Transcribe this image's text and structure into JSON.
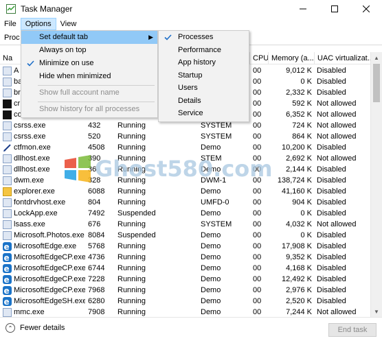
{
  "window": {
    "title": "Task Manager"
  },
  "menubar": {
    "file": "File",
    "options": "Options",
    "view": "View"
  },
  "tabs": {
    "processes_partial": "Proc"
  },
  "table": {
    "columns": {
      "name": "Na",
      "cpu": "CPU",
      "memory": "Memory (a...",
      "uac": "UAC virtualizat..."
    },
    "rows": [
      {
        "name": "A",
        "pid": "",
        "status": "",
        "user": "",
        "cpu": "00",
        "memory": "9,012 K",
        "uac": "Disabled",
        "icon": "exe-icon"
      },
      {
        "name": "ba",
        "pid": "",
        "status": "",
        "user": "",
        "cpu": "00",
        "memory": "0 K",
        "uac": "Disabled",
        "icon": "exe-icon"
      },
      {
        "name": "br",
        "pid": "",
        "status": "",
        "user": "",
        "cpu": "00",
        "memory": "2,332 K",
        "uac": "Disabled",
        "icon": "exe-icon"
      },
      {
        "name": "cr",
        "pid": "",
        "status": "",
        "user": "",
        "cpu": "00",
        "memory": "592 K",
        "uac": "Not allowed",
        "icon": "cmd-icon"
      },
      {
        "name": "co",
        "pid": "",
        "status": "",
        "user": "",
        "cpu": "00",
        "memory": "6,352 K",
        "uac": "Not allowed",
        "icon": "cmd-icon"
      },
      {
        "name": "csrss.exe",
        "pid": "432",
        "status": "Running",
        "user": "SYSTEM",
        "cpu": "00",
        "memory": "724 K",
        "uac": "Not allowed",
        "icon": "exe-icon"
      },
      {
        "name": "csrss.exe",
        "pid": "520",
        "status": "Running",
        "user": "SYSTEM",
        "cpu": "00",
        "memory": "864 K",
        "uac": "Not allowed",
        "icon": "exe-icon"
      },
      {
        "name": "ctfmon.exe",
        "pid": "4508",
        "status": "Running",
        "user": "Demo",
        "cpu": "00",
        "memory": "10,200 K",
        "uac": "Disabled",
        "icon": "pen-icon"
      },
      {
        "name": "dllhost.exe",
        "pid": "390",
        "status": "Running",
        "user": "STEM",
        "cpu": "00",
        "memory": "2,692 K",
        "uac": "Not allowed",
        "icon": "exe-icon"
      },
      {
        "name": "dllhost.exe",
        "pid": "36",
        "status": "Running",
        "user": "Demo",
        "cpu": "00",
        "memory": "2,144 K",
        "uac": "Disabled",
        "icon": "exe-icon"
      },
      {
        "name": "dwm.exe",
        "pid": "328",
        "status": "Running",
        "user": "DWM-1",
        "cpu": "00",
        "memory": "138,724 K",
        "uac": "Disabled",
        "icon": "exe-icon"
      },
      {
        "name": "explorer.exe",
        "pid": "6088",
        "status": "Running",
        "user": "Demo",
        "cpu": "00",
        "memory": "41,160 K",
        "uac": "Disabled",
        "icon": "explorer-icon"
      },
      {
        "name": "fontdrvhost.exe",
        "pid": "804",
        "status": "Running",
        "user": "UMFD-0",
        "cpu": "00",
        "memory": "904 K",
        "uac": "Disabled",
        "icon": "exe-icon"
      },
      {
        "name": "LockApp.exe",
        "pid": "7492",
        "status": "Suspended",
        "user": "Demo",
        "cpu": "00",
        "memory": "0 K",
        "uac": "Disabled",
        "icon": "exe-icon"
      },
      {
        "name": "lsass.exe",
        "pid": "676",
        "status": "Running",
        "user": "SYSTEM",
        "cpu": "00",
        "memory": "4,032 K",
        "uac": "Not allowed",
        "icon": "exe-icon"
      },
      {
        "name": "Microsoft.Photos.exe",
        "pid": "8084",
        "status": "Suspended",
        "user": "Demo",
        "cpu": "00",
        "memory": "0 K",
        "uac": "Disabled",
        "icon": "exe-icon"
      },
      {
        "name": "MicrosoftEdge.exe",
        "pid": "5768",
        "status": "Running",
        "user": "Demo",
        "cpu": "00",
        "memory": "17,908 K",
        "uac": "Disabled",
        "icon": "edge-icon"
      },
      {
        "name": "MicrosoftEdgeCP.exe",
        "pid": "4736",
        "status": "Running",
        "user": "Demo",
        "cpu": "00",
        "memory": "9,352 K",
        "uac": "Disabled",
        "icon": "edge-icon"
      },
      {
        "name": "MicrosoftEdgeCP.exe",
        "pid": "6744",
        "status": "Running",
        "user": "Demo",
        "cpu": "00",
        "memory": "4,168 K",
        "uac": "Disabled",
        "icon": "edge-icon"
      },
      {
        "name": "MicrosoftEdgeCP.exe",
        "pid": "7228",
        "status": "Running",
        "user": "Demo",
        "cpu": "00",
        "memory": "12,492 K",
        "uac": "Disabled",
        "icon": "edge-icon"
      },
      {
        "name": "MicrosoftEdgeCP.exe",
        "pid": "7968",
        "status": "Running",
        "user": "Demo",
        "cpu": "00",
        "memory": "2,976 K",
        "uac": "Disabled",
        "icon": "edge-icon"
      },
      {
        "name": "MicrosoftEdgeSH.exe",
        "pid": "6280",
        "status": "Running",
        "user": "Demo",
        "cpu": "00",
        "memory": "2,520 K",
        "uac": "Disabled",
        "icon": "edge-icon"
      },
      {
        "name": "mmc.exe",
        "pid": "7908",
        "status": "Running",
        "user": "Demo",
        "cpu": "00",
        "memory": "7,244 K",
        "uac": "Not allowed",
        "icon": "exe-icon"
      }
    ]
  },
  "options_menu": {
    "set_default_tab": "Set default tab",
    "always_on_top": "Always on top",
    "minimize_on_use": "Minimize on use",
    "hide_when_minimized": "Hide when minimized",
    "show_full_account_name": "Show full account name",
    "show_history": "Show history for all processes"
  },
  "submenu": {
    "processes": "Processes",
    "performance": "Performance",
    "app_history": "App history",
    "startup": "Startup",
    "users": "Users",
    "details": "Details",
    "service": "Service"
  },
  "footer": {
    "fewer_details": "Fewer details",
    "end_task": "End task"
  },
  "watermark": {
    "text": "Ghost580.com"
  },
  "colors": {
    "menu_highlight": "#91c9f7",
    "edge_blue": "#1a73c8",
    "disabled_text": "#8d8d8d"
  }
}
